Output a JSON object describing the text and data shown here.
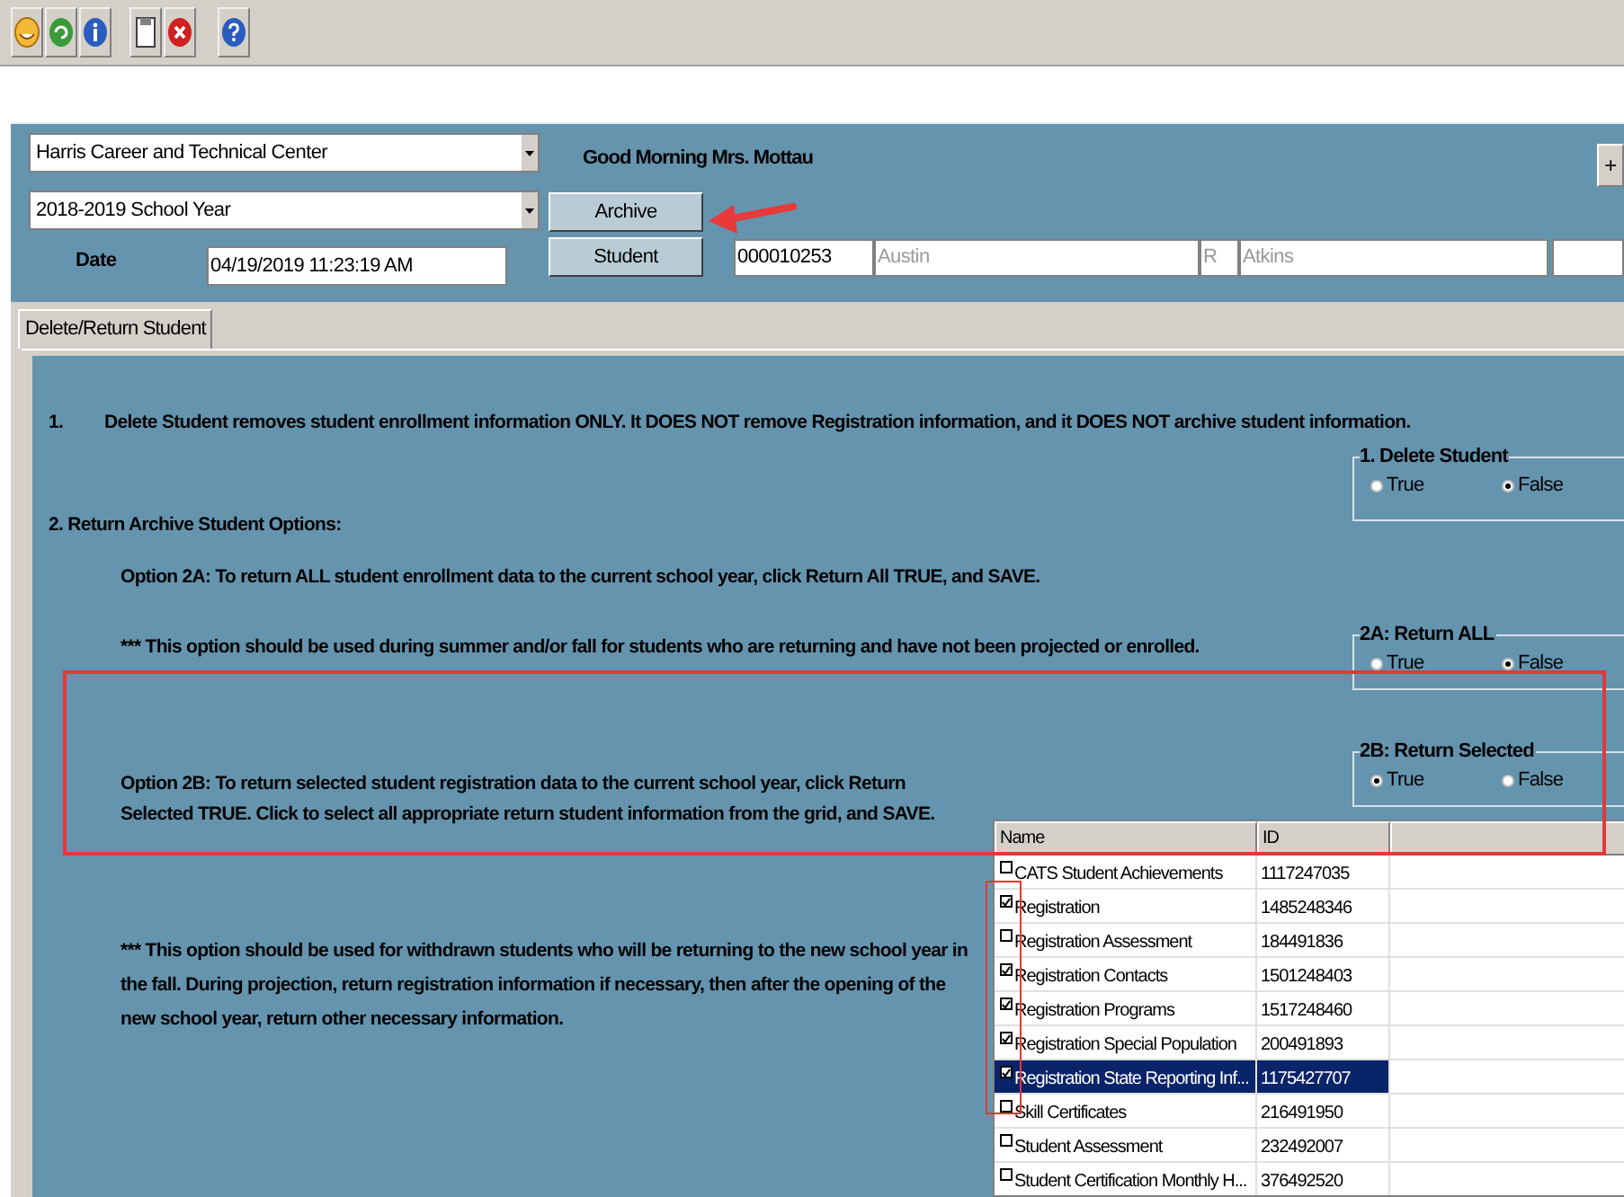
{
  "header": {
    "school": "Harris Career and Technical Center",
    "school_year": "2018-2019 School Year",
    "greeting": "Good Morning Mrs. Mottau",
    "date_label": "Date",
    "date": "04/19/2019 11:23:19 AM",
    "archive_button": "Archive",
    "student_button": "Student",
    "plus_button": "+",
    "student_fields": [
      {
        "value": "000010253",
        "disabled": false
      },
      {
        "value": "Austin",
        "disabled": true
      },
      {
        "value": "R",
        "disabled": true
      },
      {
        "value": "Atkins",
        "disabled": true
      }
    ]
  },
  "tabs": [
    {
      "label": "Delete/Return Student",
      "selected": true
    }
  ],
  "panel": {
    "note_1": {
      "number": "1.",
      "text": "Delete Student removes student enrollment information ONLY.   It DOES NOT remove Registration information, and it DOES NOT archive student information."
    },
    "section_2": "2.  Return Archive Student Options:",
    "option_2a": "Option 2A:  To return ALL student enrollment data to the current school year, click Return All TRUE, and SAVE.",
    "note_2a": "***   This option should be used during summer and/or fall for students who are returning and have not been projected or enrolled.",
    "option_2b": "Option 2B:  To return selected student registration data to the current school year, click Return Selected TRUE.  Click to select all appropriate return student information from the grid, and SAVE.",
    "note_2b": "***   This option should be used for withdrawn students who will be returning to the new school year in the fall.  During projection, return registration information if necessary, then after the opening of the new school year, return other necessary information."
  },
  "option_groups": [
    {
      "title": "1.  Delete Student",
      "options": [
        {
          "label": "True",
          "selected": false
        },
        {
          "label": "False",
          "selected": true
        }
      ]
    },
    {
      "title": "2A: Return ALL",
      "options": [
        {
          "label": "True",
          "selected": false
        },
        {
          "label": "False",
          "selected": true
        }
      ]
    },
    {
      "title": "2B: Return Selected",
      "options": [
        {
          "label": "True",
          "selected": true
        },
        {
          "label": "False",
          "selected": false
        }
      ]
    }
  ],
  "grid": {
    "columns": [
      "Name",
      "ID"
    ],
    "rows": [
      {
        "name": "CATS Student Achievements",
        "id": "1117247035",
        "checked": false,
        "selected": false
      },
      {
        "name": "Registration",
        "id": "1485248346",
        "checked": true,
        "selected": false
      },
      {
        "name": "Registration Assessment",
        "id": "184491836",
        "checked": false,
        "selected": false
      },
      {
        "name": "Registration Contacts",
        "id": "1501248403",
        "checked": true,
        "selected": false
      },
      {
        "name": "Registration Programs",
        "id": "1517248460",
        "checked": true,
        "selected": false
      },
      {
        "name": "Registration Special Population",
        "id": "200491893",
        "checked": true,
        "selected": false
      },
      {
        "name": "Registration State Reporting Inf...",
        "id": "1175427707",
        "checked": true,
        "selected": true
      },
      {
        "name": "Skill Certificates",
        "id": "216491950",
        "checked": false,
        "selected": false
      },
      {
        "name": "Student Assessment",
        "id": "232492007",
        "checked": false,
        "selected": false
      },
      {
        "name": "Student Certification Monthly H...",
        "id": "376492520",
        "checked": false,
        "selected": false
      }
    ]
  }
}
